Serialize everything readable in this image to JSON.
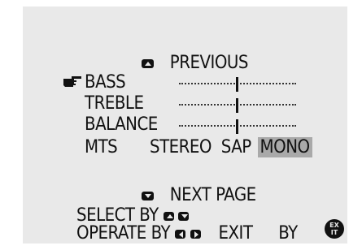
{
  "menu": {
    "previous_label": "PREVIOUS",
    "items": [
      {
        "label": "BASS",
        "level": 0.5
      },
      {
        "label": "TREBLE",
        "level": 0.5
      },
      {
        "label": "BALANCE",
        "level": 0.5
      }
    ],
    "mts": {
      "label": "MTS",
      "options": [
        "STEREO",
        "SAP",
        "MONO"
      ],
      "selected": "MONO"
    },
    "next_page_label": "NEXT PAGE",
    "select_label": "SELECT  BY",
    "operate_label": "OPERATE BY",
    "exit_label": "EXIT",
    "by_label": "BY",
    "exit_button_text": "EX\nIT"
  },
  "colors": {
    "screen_bg": "#e9e9e9",
    "highlight": "#a9a9a9",
    "text": "#111111"
  },
  "icons": {
    "cursor": "pointing-hand-icon",
    "up": "up-arrow-button-icon",
    "down": "down-arrow-button-icon",
    "left": "left-arrow-button-icon",
    "right": "right-arrow-button-icon",
    "exit": "exit-button-icon"
  }
}
